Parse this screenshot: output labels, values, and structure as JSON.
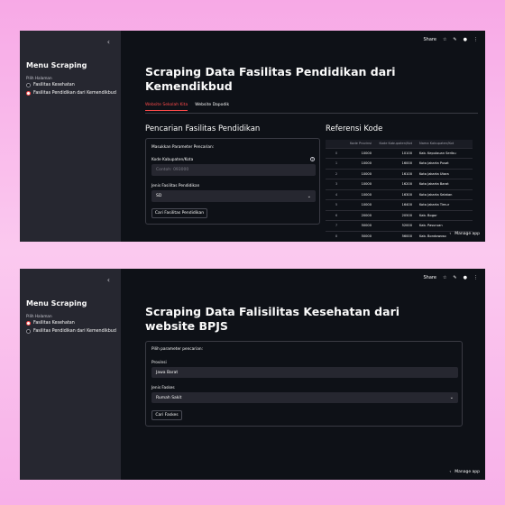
{
  "window1": {
    "sidebar": {
      "title": "Menu Scraping",
      "label": "Pilih Halaman",
      "options": [
        "Fasilitas Kesehatan",
        "Fasilitas Pendidikan dari Kemendikbud"
      ]
    },
    "topbar": {
      "share": "Share"
    },
    "title": "Scraping Data Fasilitas Pendidikan dari Kemendikbud",
    "tabs": [
      "Website Sekolah Kita",
      "Website Dapodik"
    ],
    "form_heading": "Pencarian Fasilitas Pendidikan",
    "form_label": "Masukkan Parameter Pencarian:",
    "kode_label": "Kode Kabupaten/Kota",
    "kode_placeholder": "Contoh: 093000",
    "jenis_label": "Jenis Fasilitas Pendidikan",
    "jenis_value": "SD",
    "button": "Cari Fasilitas Pendidikan",
    "ref_heading": "Referensi Kode",
    "table": {
      "headers": [
        "",
        "Kode Provinsi",
        "Kode Kabupaten/Kot",
        "Nama Kabupaten/Kot"
      ],
      "rows": [
        [
          "0",
          "10000",
          "10100",
          "Kab. Kepulauan Seribu"
        ],
        [
          "1",
          "10000",
          "16000",
          "Kota Jakarta Pusat"
        ],
        [
          "2",
          "10000",
          "16100",
          "Kota Jakarta Utara"
        ],
        [
          "3",
          "10000",
          "16200",
          "Kota Jakarta Barat"
        ],
        [
          "4",
          "10000",
          "16300",
          "Kota Jakarta Selatan"
        ],
        [
          "5",
          "10000",
          "16400",
          "Kota Jakarta Timur"
        ],
        [
          "6",
          "20000",
          "20500",
          "Kab. Bogor"
        ],
        [
          "7",
          "50000",
          "52000",
          "Kab. Pasuruan"
        ],
        [
          "8",
          "50000",
          "56000",
          "Kab. Bondowoso"
        ]
      ]
    },
    "manage": "Manage app"
  },
  "window2": {
    "sidebar": {
      "title": "Menu Scraping",
      "label": "Pilih Halaman",
      "options": [
        "Fasilitas Kesehatan",
        "Fasilitas Pendidikan dari Kemendikbud"
      ]
    },
    "topbar": {
      "share": "Share"
    },
    "title": "Scraping Data Falisilitas Kesehatan dari website BPJS",
    "form_label": "Pilih parameter pencarian:",
    "provinsi_label": "Provinsi",
    "provinsi_value": "Jawa Barat",
    "jenis_label": "Jenis Faskes",
    "jenis_value": "Rumah Sakit",
    "button": "Cari Faskes",
    "manage": "Manage app"
  },
  "colors": {
    "accent": "#ff4b4b",
    "bg": "#0e1117",
    "sidebar": "#262730"
  }
}
